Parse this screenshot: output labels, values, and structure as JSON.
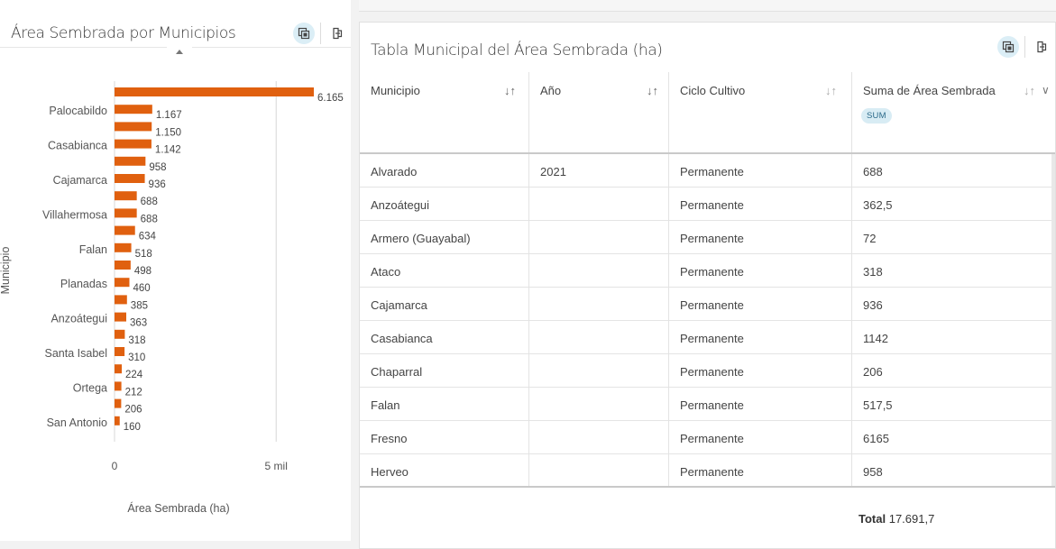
{
  "chart_panel": {
    "title": "Área Sembrada por Municipios",
    "icons": [
      "maximize-icon",
      "export-icon"
    ]
  },
  "chart_data": {
    "type": "bar",
    "orientation": "horizontal",
    "ylabel": "Municipio",
    "xlabel": "Área Sembrada (ha)",
    "xlim": [
      0,
      6500
    ],
    "xticks": [
      {
        "value": 0,
        "label": "0"
      },
      {
        "value": 5000,
        "label": "5 mil"
      }
    ],
    "categories": [
      "",
      "Palocabildo",
      "",
      "Casabianca",
      "",
      "Cajamarca",
      "",
      "Villahermosa",
      "",
      "Falan",
      "",
      "Planadas",
      "",
      "Anzoátegui",
      "",
      "Santa Isabel",
      "",
      "Ortega",
      "",
      "San Antonio"
    ],
    "values": [
      6165,
      1167,
      1150,
      1142,
      958,
      936,
      688,
      688,
      634,
      518,
      498,
      460,
      385,
      363,
      318,
      310,
      224,
      212,
      206,
      160
    ],
    "value_labels": [
      "6.165",
      "1.167",
      "1.150",
      "1.142",
      "958",
      "936",
      "688",
      "688",
      "634",
      "518",
      "498",
      "460",
      "385",
      "363",
      "318",
      "310",
      "224",
      "212",
      "206",
      "160"
    ],
    "bar_color": "#e0600f",
    "grid": "vertical"
  },
  "table_panel": {
    "title": "Tabla Municipal del Área Sembrada (ha)",
    "icons": [
      "maximize-icon",
      "export-icon"
    ],
    "columns": [
      {
        "label": "Municipio",
        "sort_icon": "↓↑"
      },
      {
        "label": "Año",
        "sort_icon": "↓↑"
      },
      {
        "label": "Ciclo Cultivo",
        "sort_icon": "↓↑"
      },
      {
        "label": "Suma de Área Sembrada",
        "sort_icon": "↓↑",
        "badge": "SUM"
      }
    ],
    "rows": [
      [
        "Alvarado",
        "2021",
        "Permanente",
        "688"
      ],
      [
        "Anzoátegui",
        "",
        "Permanente",
        "362,5"
      ],
      [
        "Armero (Guayabal)",
        "",
        "Permanente",
        "72"
      ],
      [
        "Ataco",
        "",
        "Permanente",
        "318"
      ],
      [
        "Cajamarca",
        "",
        "Permanente",
        "936"
      ],
      [
        "Casabianca",
        "",
        "Permanente",
        "1142"
      ],
      [
        "Chaparral",
        "",
        "Permanente",
        "206"
      ],
      [
        "Falan",
        "",
        "Permanente",
        "517,5"
      ],
      [
        "Fresno",
        "",
        "Permanente",
        "6165"
      ],
      [
        "Herveo",
        "",
        "Permanente",
        "958"
      ]
    ],
    "total_label": "Total",
    "total_value": "17.691,7",
    "accent": "#dbeef6"
  }
}
